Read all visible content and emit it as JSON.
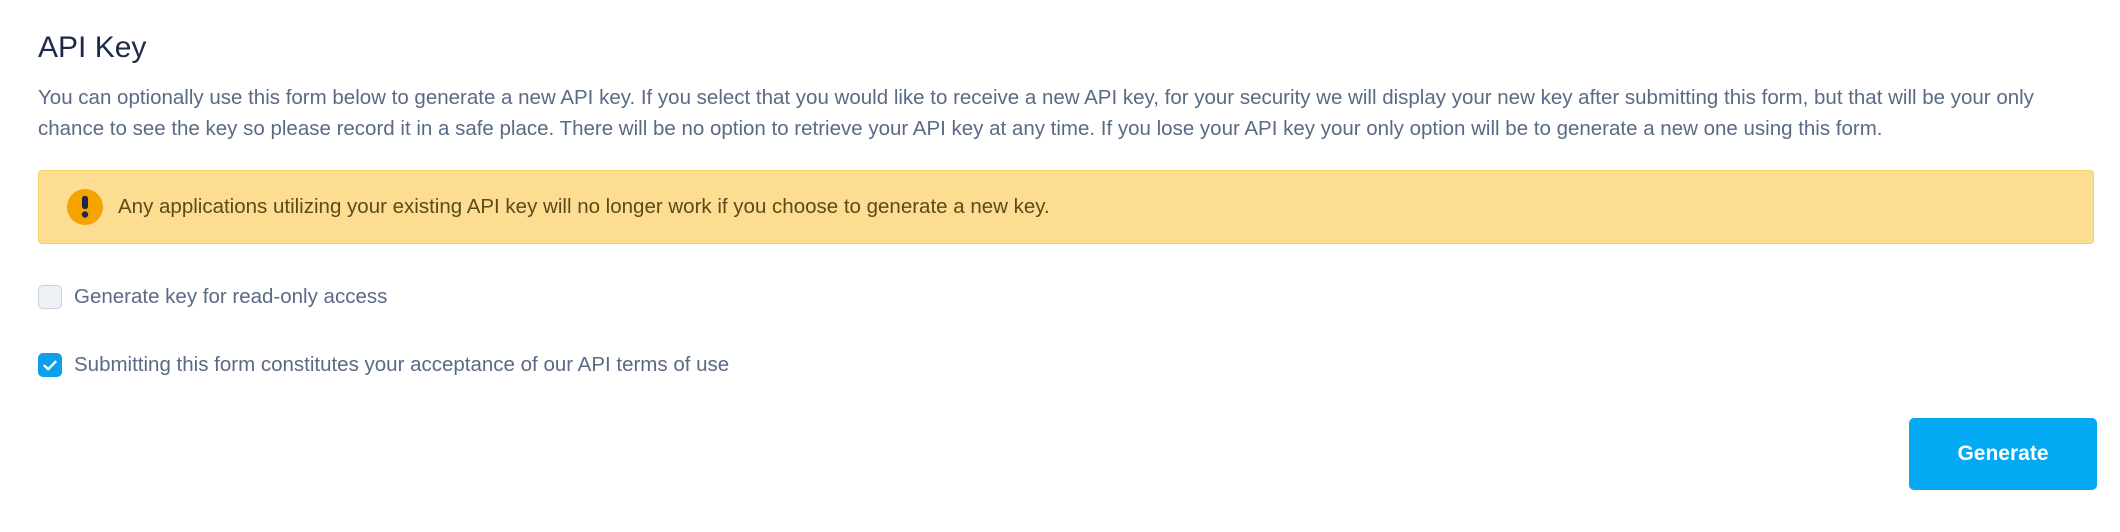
{
  "section": {
    "title": "API Key",
    "description": "You can optionally use this form below to generate a new API key. If you select that you would like to receive a new API key, for your security we will display your new key after submitting this form, but that will be your only chance to see the key so please record it in a safe place. There will be no option to retrieve your API key at any time. If you lose your API key your only option will be to generate a new one using this form."
  },
  "alert": {
    "icon": "exclamation-icon",
    "text": "Any applications utilizing your existing API key will no longer work if you choose to generate a new key.",
    "background_color": "#fddd91",
    "icon_color": "#f4a300"
  },
  "options": [
    {
      "label": "Generate key for read-only access",
      "checked": false
    },
    {
      "label": "Submitting this form constitutes your acceptance of our API terms of use",
      "checked": true
    }
  ],
  "actions": {
    "generate_label": "Generate",
    "button_color": "#04a9f4"
  }
}
